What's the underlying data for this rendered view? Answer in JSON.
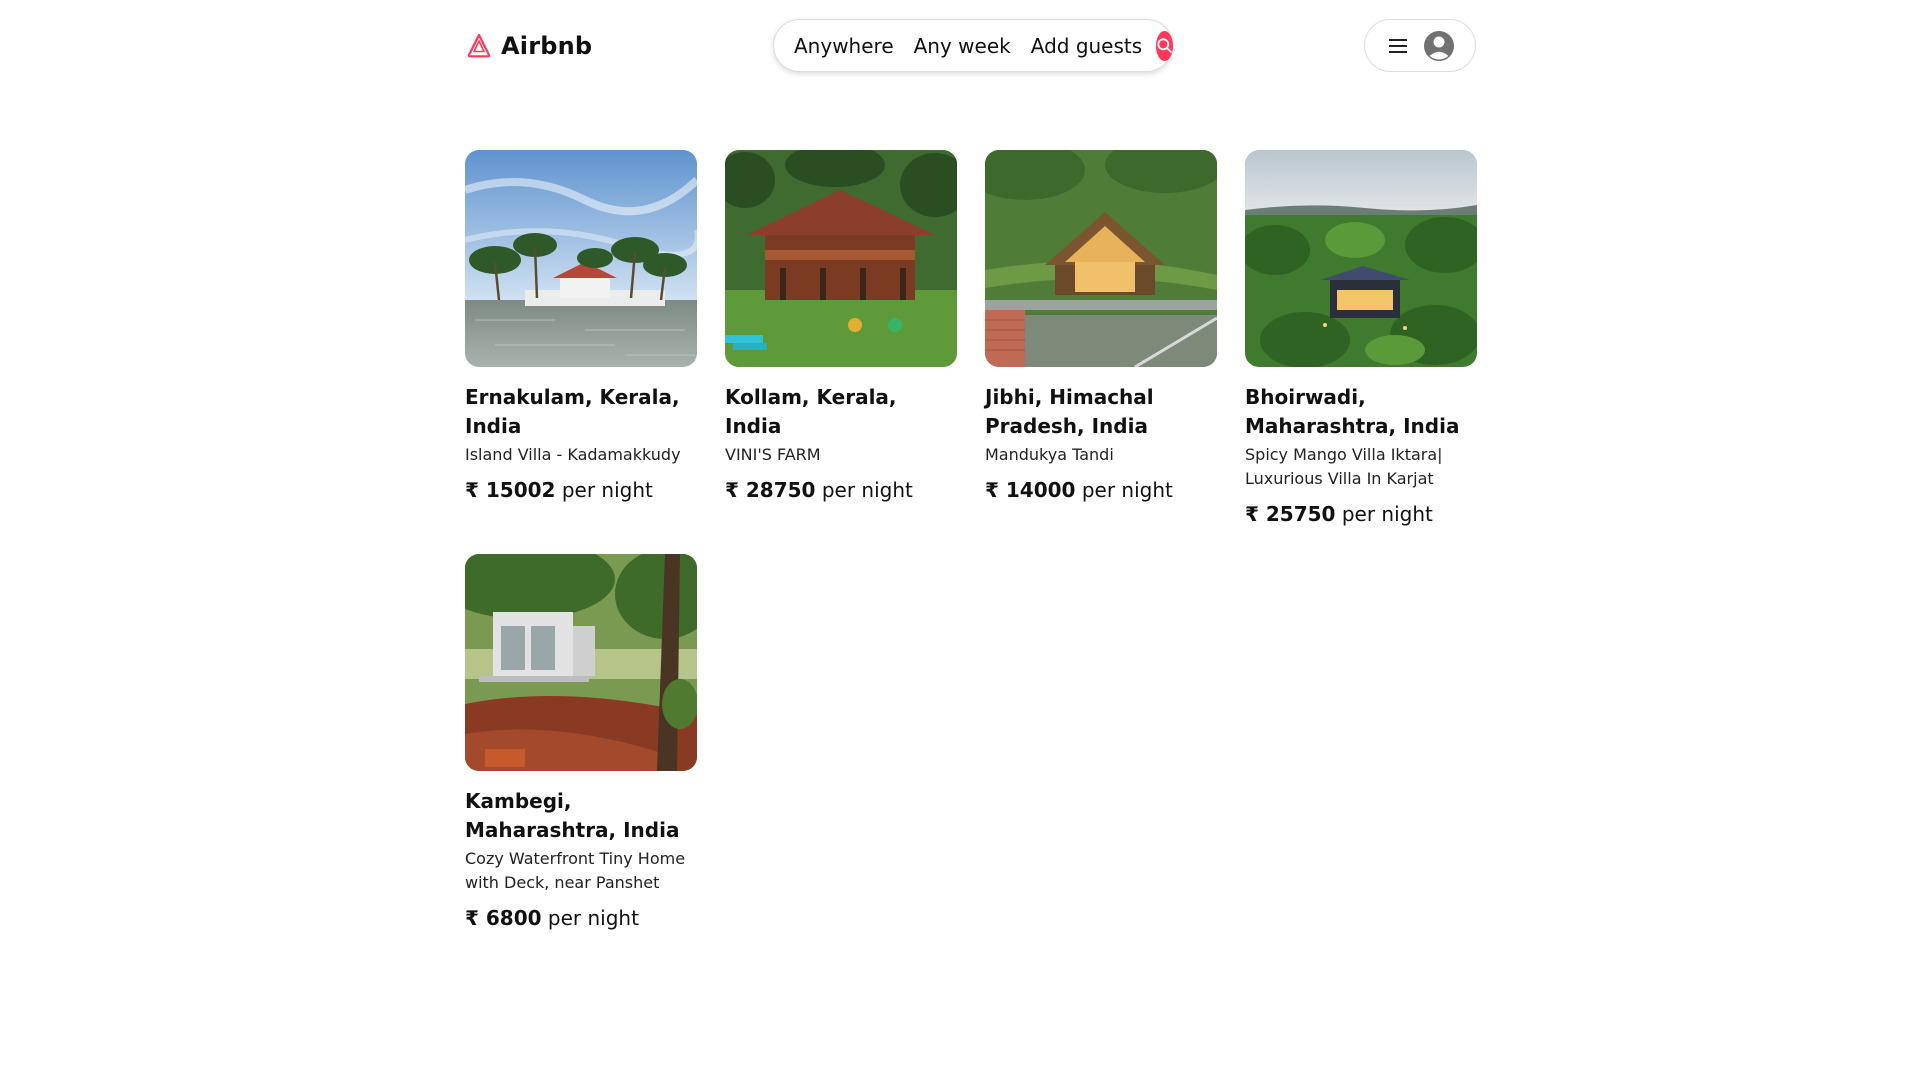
{
  "brand": {
    "name": "Airbnb",
    "logo_icon": "airbnb-logo-icon",
    "accent": "#ff385c"
  },
  "search": {
    "anywhere": "Anywhere",
    "week": "Any week",
    "guests": "Add guests",
    "icon": "search-icon"
  },
  "user_menu": {
    "menu_icon": "hamburger-menu-icon",
    "avatar_icon": "user-avatar-icon"
  },
  "listings": [
    {
      "location": "Ernakulam, Kerala, India",
      "title": "Island Villa - Kadamakkudy",
      "currency": "₹",
      "price": "15002",
      "unit": "per night"
    },
    {
      "location": "Kollam, Kerala, India",
      "title": "VINI'S FARM",
      "currency": "₹",
      "price": "28750",
      "unit": "per night"
    },
    {
      "location": "Jibhi, Himachal Pradesh, India",
      "title": "Mandukya Tandi",
      "currency": "₹",
      "price": "14000",
      "unit": "per night"
    },
    {
      "location": "Bhoirwadi, Maharashtra, India",
      "title": "Spicy Mango Villa Iktara| Luxurious Villa In Karjat",
      "currency": "₹",
      "price": "25750",
      "unit": "per night"
    },
    {
      "location": "Kambegi, Maharashtra, India",
      "title": "Cozy Waterfront Tiny Home with Deck, near Panshet",
      "currency": "₹",
      "price": "6800",
      "unit": "per night"
    }
  ]
}
